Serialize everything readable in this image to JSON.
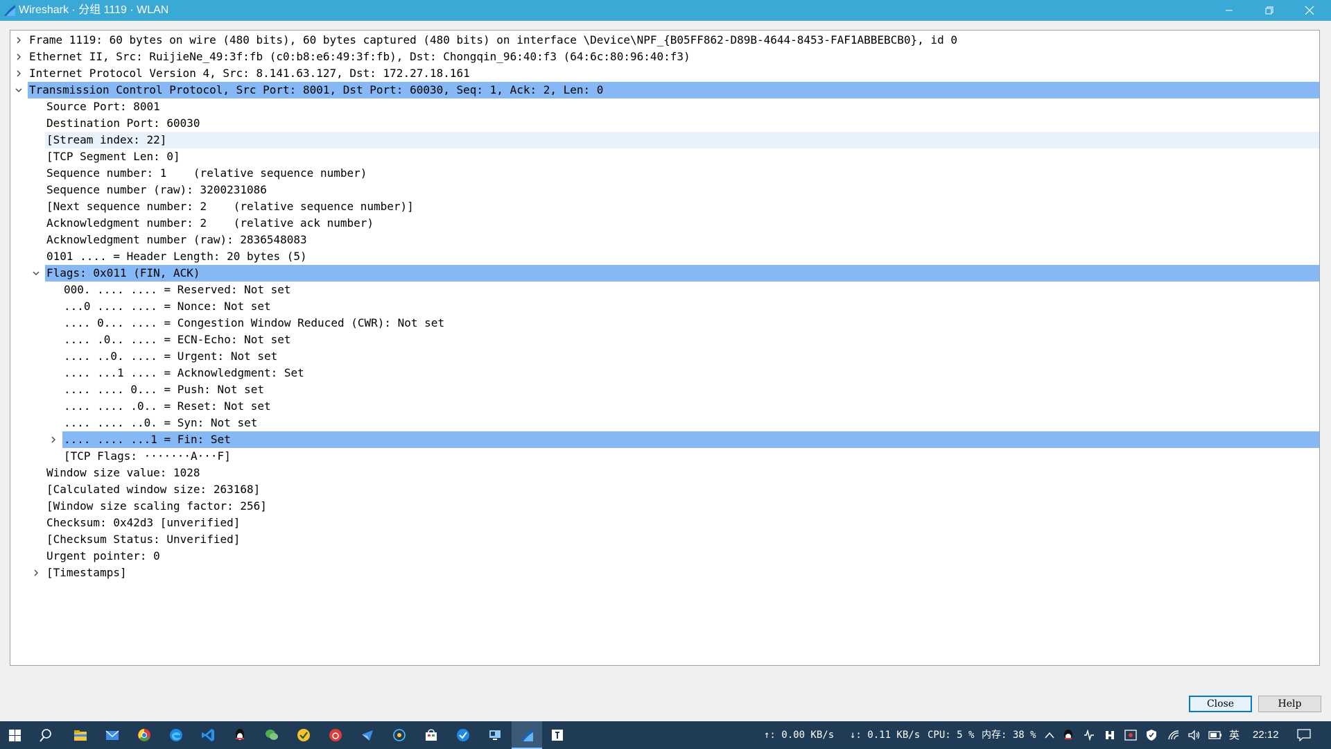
{
  "window": {
    "title": "Wireshark · 分组 1119 · WLAN",
    "minimize_glyph": "—",
    "restore_glyph": "❐",
    "close_glyph": "✕"
  },
  "tree": {
    "rows": [
      {
        "text": "Frame 1119: 60 bytes on wire (480 bits), 60 bytes captured (480 bits) on interface \\Device\\NPF_{B05FF862-D89B-4644-8453-FAF1ABBEBCB0}, id 0",
        "level": 0,
        "arrow": "collapsed",
        "state": "normal"
      },
      {
        "text": "Ethernet II, Src: RuijieNe_49:3f:fb (c0:b8:e6:49:3f:fb), Dst: Chongqin_96:40:f3 (64:6c:80:96:40:f3)",
        "level": 0,
        "arrow": "collapsed",
        "state": "normal"
      },
      {
        "text": "Internet Protocol Version 4, Src: 8.141.63.127, Dst: 172.27.18.161",
        "level": 0,
        "arrow": "collapsed",
        "state": "normal"
      },
      {
        "text": "Transmission Control Protocol, Src Port: 8001, Dst Port: 60030, Seq: 1, Ack: 2, Len: 0",
        "level": 0,
        "arrow": "expanded",
        "state": "selected"
      },
      {
        "text": "Source Port: 8001",
        "level": 1,
        "arrow": "none",
        "state": "normal"
      },
      {
        "text": "Destination Port: 60030",
        "level": 1,
        "arrow": "none",
        "state": "normal"
      },
      {
        "text": "[Stream index: 22]",
        "level": 1,
        "arrow": "none",
        "state": "hover"
      },
      {
        "text": "[TCP Segment Len: 0]",
        "level": 1,
        "arrow": "none",
        "state": "normal"
      },
      {
        "text": "Sequence number: 1    (relative sequence number)",
        "level": 1,
        "arrow": "none",
        "state": "normal"
      },
      {
        "text": "Sequence number (raw): 3200231086",
        "level": 1,
        "arrow": "none",
        "state": "normal"
      },
      {
        "text": "[Next sequence number: 2    (relative sequence number)]",
        "level": 1,
        "arrow": "none",
        "state": "normal"
      },
      {
        "text": "Acknowledgment number: 2    (relative ack number)",
        "level": 1,
        "arrow": "none",
        "state": "normal"
      },
      {
        "text": "Acknowledgment number (raw): 2836548083",
        "level": 1,
        "arrow": "none",
        "state": "normal"
      },
      {
        "text": "0101 .... = Header Length: 20 bytes (5)",
        "level": 1,
        "arrow": "none",
        "state": "normal"
      },
      {
        "text": "Flags: 0x011 (FIN, ACK)",
        "level": 1,
        "arrow": "expanded",
        "state": "selected"
      },
      {
        "text": "000. .... .... = Reserved: Not set",
        "level": 2,
        "arrow": "none",
        "state": "normal"
      },
      {
        "text": "...0 .... .... = Nonce: Not set",
        "level": 2,
        "arrow": "none",
        "state": "normal"
      },
      {
        "text": ".... 0... .... = Congestion Window Reduced (CWR): Not set",
        "level": 2,
        "arrow": "none",
        "state": "normal"
      },
      {
        "text": ".... .0.. .... = ECN-Echo: Not set",
        "level": 2,
        "arrow": "none",
        "state": "normal"
      },
      {
        "text": ".... ..0. .... = Urgent: Not set",
        "level": 2,
        "arrow": "none",
        "state": "normal"
      },
      {
        "text": ".... ...1 .... = Acknowledgment: Set",
        "level": 2,
        "arrow": "none",
        "state": "normal"
      },
      {
        "text": ".... .... 0... = Push: Not set",
        "level": 2,
        "arrow": "none",
        "state": "normal"
      },
      {
        "text": ".... .... .0.. = Reset: Not set",
        "level": 2,
        "arrow": "none",
        "state": "normal"
      },
      {
        "text": ".... .... ..0. = Syn: Not set",
        "level": 2,
        "arrow": "none",
        "state": "normal"
      },
      {
        "text": ".... .... ...1 = Fin: Set",
        "level": 2,
        "arrow": "collapsed",
        "state": "selected"
      },
      {
        "text": "[TCP Flags: ·······A···F]",
        "level": 2,
        "arrow": "none",
        "state": "normal"
      },
      {
        "text": "Window size value: 1028",
        "level": 1,
        "arrow": "none",
        "state": "normal"
      },
      {
        "text": "[Calculated window size: 263168]",
        "level": 1,
        "arrow": "none",
        "state": "normal"
      },
      {
        "text": "[Window size scaling factor: 256]",
        "level": 1,
        "arrow": "none",
        "state": "normal"
      },
      {
        "text": "Checksum: 0x42d3 [unverified]",
        "level": 1,
        "arrow": "none",
        "state": "normal"
      },
      {
        "text": "[Checksum Status: Unverified]",
        "level": 1,
        "arrow": "none",
        "state": "normal"
      },
      {
        "text": "Urgent pointer: 0",
        "level": 1,
        "arrow": "none",
        "state": "normal"
      },
      {
        "text": "[Timestamps]",
        "level": 1,
        "arrow": "collapsed",
        "state": "normal"
      }
    ]
  },
  "buttons": {
    "close_label": "Close",
    "help_label": "Help"
  },
  "taskbar": {
    "apps": [
      {
        "name": "start-icon"
      },
      {
        "name": "search-icon"
      },
      {
        "name": "file-explorer-icon"
      },
      {
        "name": "mail-icon"
      },
      {
        "name": "chrome-icon"
      },
      {
        "name": "edge-icon"
      },
      {
        "name": "vscode-icon"
      },
      {
        "name": "qq-icon"
      },
      {
        "name": "wechat-icon"
      },
      {
        "name": "norton-icon"
      },
      {
        "name": "netease-music-icon"
      },
      {
        "name": "feishu-icon"
      },
      {
        "name": "network-tool-icon"
      },
      {
        "name": "store-icon"
      },
      {
        "name": "todo-icon"
      },
      {
        "name": "remote-desktop-icon"
      },
      {
        "name": "wireshark-icon"
      },
      {
        "name": "typora-icon"
      }
    ],
    "upload": "↑: 0.00 KB/s",
    "download": "↓: 0.11 KB/s",
    "cpu": "CPU: 5 %",
    "memory": "内存: 38 %",
    "ime": "英",
    "time": "22:12"
  },
  "colors": {
    "titlebar": "#3aa9d6",
    "selection": "#86b8f5",
    "hover": "#e8f2fc",
    "taskbar": "#1f3b55"
  }
}
